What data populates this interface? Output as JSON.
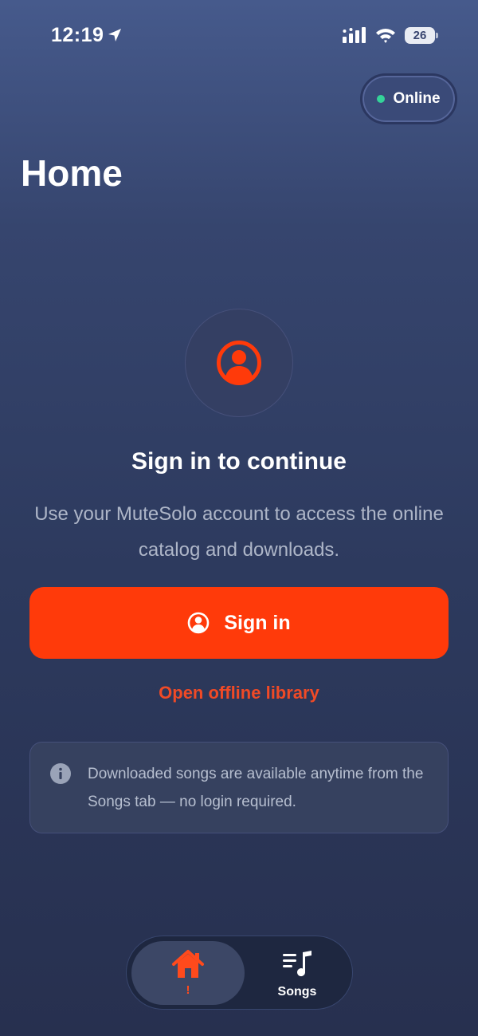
{
  "status_bar": {
    "time": "12:19",
    "battery": "26",
    "icons": [
      "location-arrow-icon",
      "signal-icon",
      "wifi-icon",
      "battery-icon"
    ]
  },
  "header": {
    "status_label": "Online",
    "status_color": "#34d399",
    "title": "Home"
  },
  "main": {
    "avatar_icon": "user-circle-icon",
    "headline": "Sign in to continue",
    "subtext": "Use your MuteSolo account to access the online catalog and downloads.",
    "signin_label": "Sign in",
    "signin_icon": "user-circle-icon",
    "offline_link": "Open offline library",
    "info_icon": "info-icon",
    "info_text": "Downloaded songs are available anytime from the Songs tab — no login required."
  },
  "tab_bar": {
    "tabs": [
      {
        "label": "!",
        "icon": "home-icon",
        "selected": true
      },
      {
        "label": "Songs",
        "icon": "music-list-icon",
        "selected": false
      }
    ]
  },
  "colors": {
    "accent": "#ff3a0a",
    "link": "#f04a26",
    "background_top": "#465a8c",
    "background_bottom": "#27304f"
  }
}
